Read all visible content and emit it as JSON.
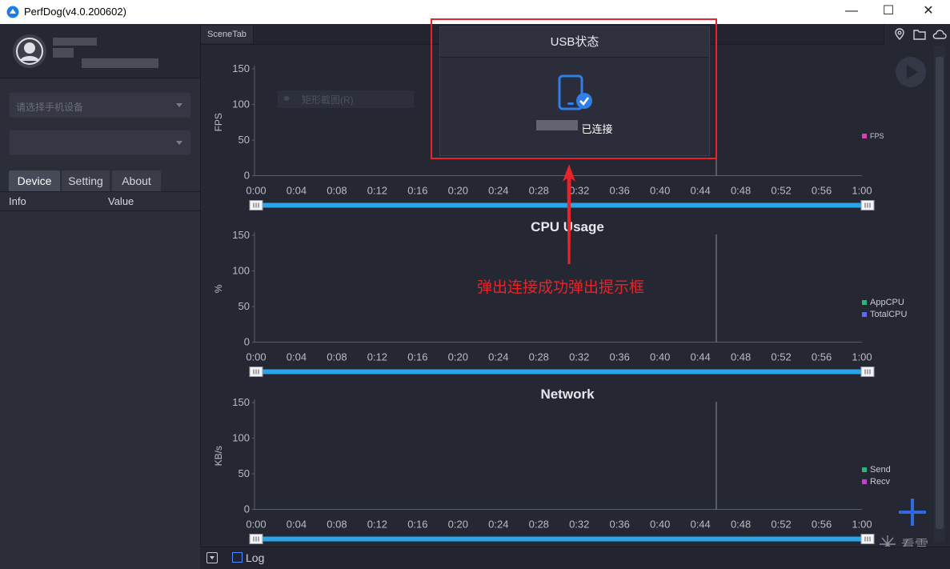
{
  "window": {
    "title": "PerfDog(v4.0.200602)",
    "buttons": {
      "minimize": "—",
      "maximize": "☐",
      "close": "✕"
    }
  },
  "sidebar": {
    "device_select_placeholder": "请选择手机设备",
    "app_select_placeholder": "",
    "tabs": [
      {
        "label": "Device",
        "active": true
      },
      {
        "label": "Setting",
        "active": false
      },
      {
        "label": "About",
        "active": false
      }
    ],
    "table_headers": {
      "info": "Info",
      "value": "Value"
    }
  },
  "scene": {
    "tab_label": "SceneTab",
    "tool_icons": [
      "location-icon",
      "folder-icon",
      "cloud-icon"
    ],
    "faded_overlay_text": "矩形截图(R)"
  },
  "popup": {
    "title": "USB状态",
    "status": "已连接",
    "accent": "#2f7fe6"
  },
  "annotation": "弹出连接成功弹出提示框",
  "bottom": {
    "log_label": "Log"
  },
  "colors": {
    "fps": "#d73fb5",
    "app_cpu": "#2bb673",
    "total_cpu": "#5b6cf0",
    "send": "#2bb673",
    "recv": "#c33fd1",
    "slider": "#2aa5ea",
    "highlight": "#e8242a"
  },
  "chart_data": [
    {
      "type": "line",
      "title": "",
      "ylabel": "FPS",
      "yticks": [
        "150",
        "100",
        "50",
        "0"
      ],
      "xticks": [
        "0:00",
        "0:04",
        "0:08",
        "0:12",
        "0:16",
        "0:20",
        "0:24",
        "0:28",
        "0:32",
        "0:36",
        "0:40",
        "0:44",
        "0:48",
        "0:52",
        "0:56",
        "1:00"
      ],
      "ylim": [
        0,
        150
      ],
      "series": [
        {
          "name": "FPS",
          "values": []
        }
      ],
      "legend": [
        "FPS"
      ],
      "legend_placement": "right"
    },
    {
      "type": "line",
      "title": "CPU Usage",
      "ylabel": "%",
      "yticks": [
        "150",
        "100",
        "50",
        "0"
      ],
      "xticks": [
        "0:00",
        "0:04",
        "0:08",
        "0:12",
        "0:16",
        "0:20",
        "0:24",
        "0:28",
        "0:32",
        "0:36",
        "0:40",
        "0:44",
        "0:48",
        "0:52",
        "0:56",
        "1:00"
      ],
      "ylim": [
        0,
        150
      ],
      "series": [
        {
          "name": "AppCPU",
          "values": []
        },
        {
          "name": "TotalCPU",
          "values": []
        }
      ],
      "legend": [
        "AppCPU",
        "TotalCPU"
      ],
      "legend_placement": "right"
    },
    {
      "type": "line",
      "title": "Network",
      "ylabel": "KB/s",
      "yticks": [
        "150",
        "100",
        "50",
        "0"
      ],
      "xticks": [
        "0:00",
        "0:04",
        "0:08",
        "0:12",
        "0:16",
        "0:20",
        "0:24",
        "0:28",
        "0:32",
        "0:36",
        "0:40",
        "0:44",
        "0:48",
        "0:52",
        "0:56",
        "1:00"
      ],
      "ylim": [
        0,
        150
      ],
      "series": [
        {
          "name": "Send",
          "values": []
        },
        {
          "name": "Recv",
          "values": []
        }
      ],
      "legend": [
        "Send",
        "Recv"
      ],
      "legend_placement": "right"
    }
  ]
}
